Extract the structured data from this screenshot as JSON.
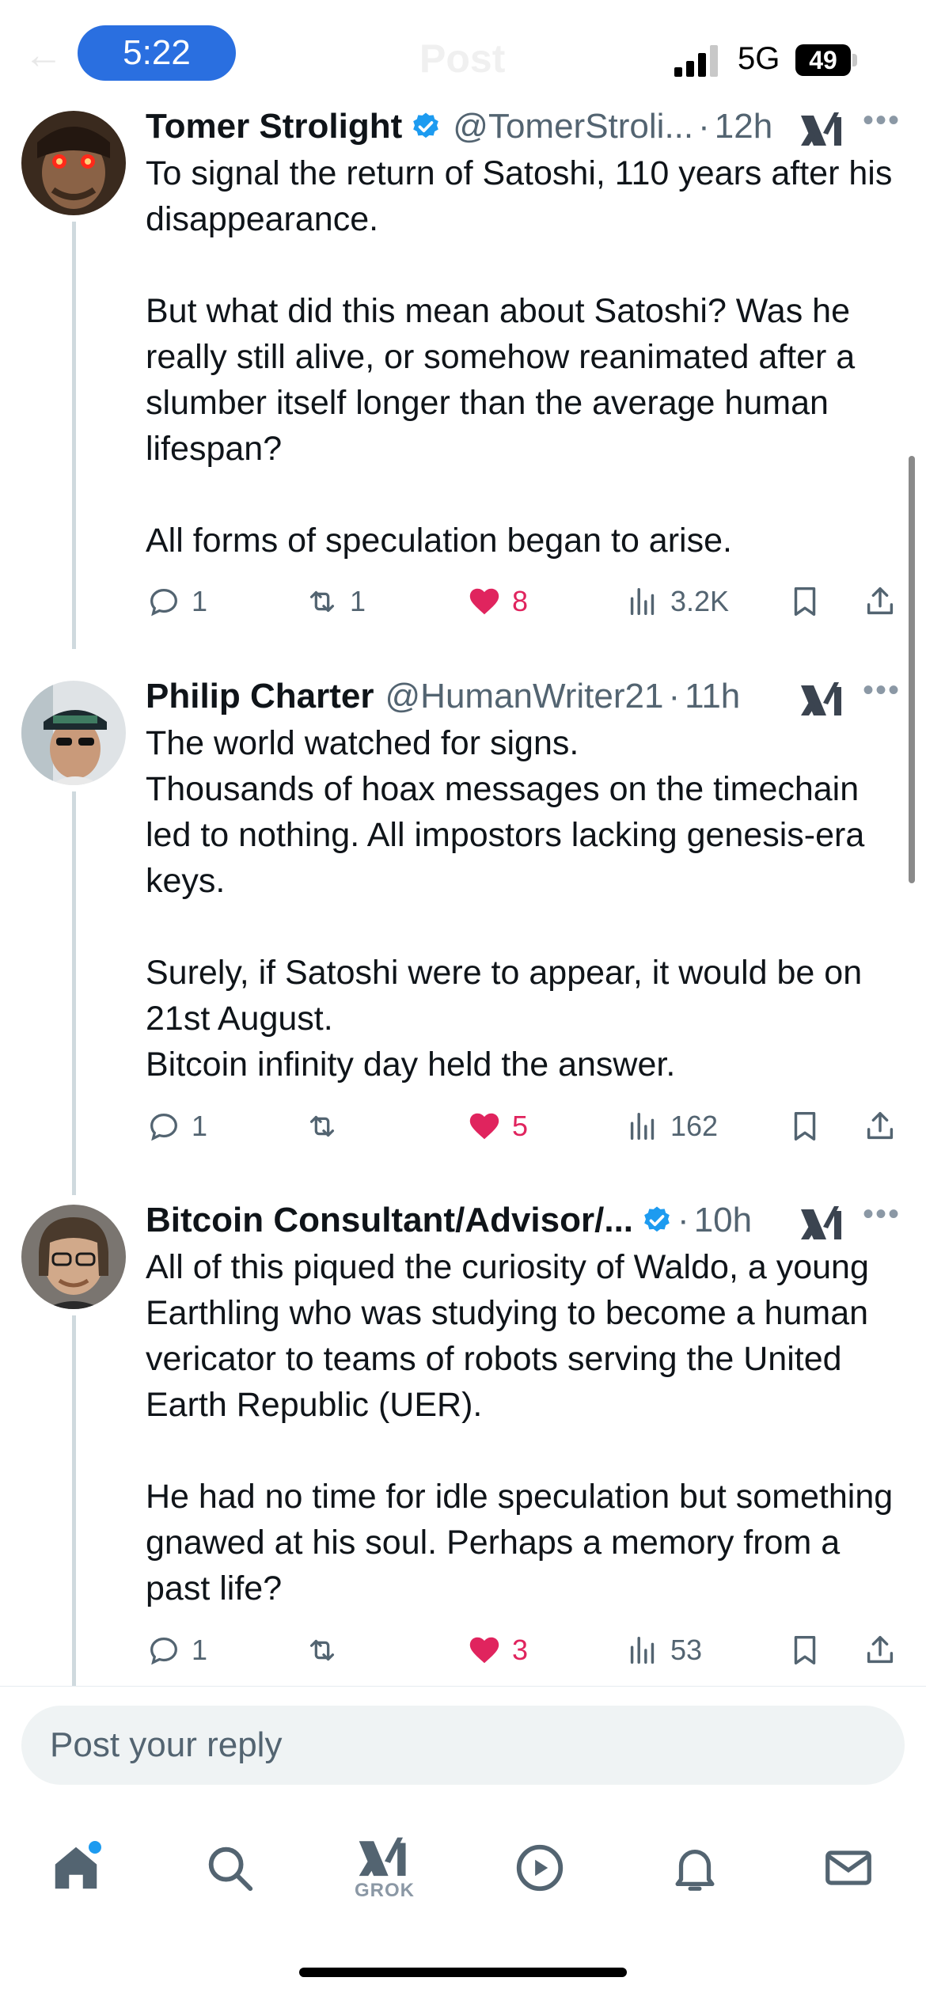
{
  "status_bar": {
    "time": "5:22",
    "network": "5G",
    "battery": "49",
    "header_title": "Post"
  },
  "tweets": [
    {
      "name": "Tomer Strolight",
      "handle": "@TomerStroli...",
      "age": "12h",
      "verified": true,
      "text": "To signal the return of Satoshi, 110 years after his disappearance.\n\nBut what did this mean about Satoshi? Was he really still alive, or somehow reanimated after a slumber itself longer than the average human lifespan?\n\nAll forms of speculation began to arise.",
      "replies": "1",
      "reposts": "1",
      "likes": "8",
      "views": "3.2K"
    },
    {
      "name": "Philip Charter",
      "handle": "@HumanWriter21",
      "age": "11h",
      "verified": false,
      "text": "The world watched for signs.\nThousands of hoax messages on the timechain led to nothing. All impostors lacking genesis-era keys.\n\nSurely, if Satoshi were to appear, it would be on 21st August.\nBitcoin infinity day held the answer.",
      "replies": "1",
      "reposts": "",
      "likes": "5",
      "views": "162"
    },
    {
      "name": "Bitcoin Consultant/Advisor/...",
      "handle": "",
      "age": "10h",
      "verified": true,
      "text": "All of this piqued the curiosity of Waldo, a young Earthling who was studying to become a human vericator to teams of robots serving the United Earth Republic (UER).\n\nHe had no time for idle speculation but something gnawed at his soul. Perhaps a memory from a past life?",
      "replies": "1",
      "reposts": "",
      "likes": "3",
      "views": "53"
    }
  ],
  "reply": {
    "placeholder": "Post your reply"
  },
  "nav": {
    "items": [
      "home-icon",
      "search-icon",
      "grok-icon",
      "play-icon",
      "bell-icon",
      "mail-icon"
    ],
    "grok_label": "GROK"
  },
  "colors": {
    "accent": "#1d9bf0",
    "like": "#e0245e",
    "muted": "#536471",
    "time_pill": "#2a6fe0"
  }
}
